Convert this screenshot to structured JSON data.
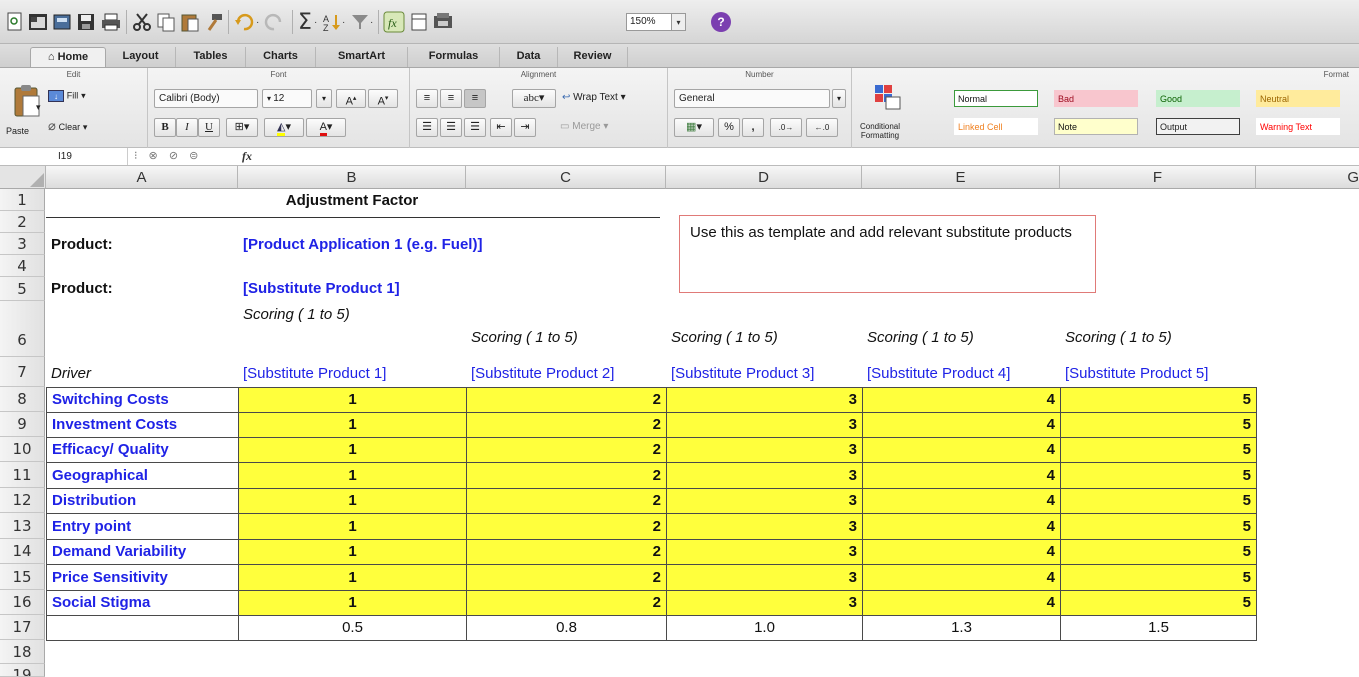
{
  "toolbar": {
    "zoom": "150%"
  },
  "tabs": [
    "Home",
    "Layout",
    "Tables",
    "Charts",
    "SmartArt",
    "Formulas",
    "Data",
    "Review"
  ],
  "ribbon": {
    "groups": {
      "edit": "Edit",
      "font": "Font",
      "alignment": "Alignment",
      "number": "Number",
      "format": "Format"
    },
    "paste": "Paste",
    "fill": "Fill",
    "clear": "Clear",
    "font_name": "Calibri (Body)",
    "font_size": "12",
    "wrap_text": "Wrap Text",
    "merge": "Merge",
    "abc": "abc",
    "number_format": "General",
    "percent": "%",
    "comma": ",",
    "conditional_formatting": [
      "Conditional",
      "Formatting"
    ],
    "styles": [
      {
        "label": "Normal",
        "bg": "#ffffff",
        "color": "#111111",
        "border": "#3b9a3b"
      },
      {
        "label": "Bad",
        "bg": "#f8c6ce",
        "color": "#9c0a1e",
        "border": "#f8c6ce"
      },
      {
        "label": "Good",
        "bg": "#c6efce",
        "color": "#0a6100",
        "border": "#c6efce"
      },
      {
        "label": "Neutral",
        "bg": "#ffeb9c",
        "color": "#9c6500",
        "border": "#ffeb9c"
      },
      {
        "label": "Linked Cell",
        "bg": "#ffffff",
        "color": "#f08020",
        "border": "#ffffff"
      },
      {
        "label": "Note",
        "bg": "#ffffcc",
        "color": "#111111",
        "border": "#b2b2b2"
      },
      {
        "label": "Output",
        "bg": "#f2f2f2",
        "color": "#222222",
        "border": "#3f3f3f"
      },
      {
        "label": "Warning Text",
        "bg": "#ffffff",
        "color": "#ff0000",
        "border": "#ffffff"
      }
    ]
  },
  "formula_bar": {
    "cell_ref": "I19",
    "fx": "fx"
  },
  "columns": [
    "A",
    "B",
    "C",
    "D",
    "E",
    "F",
    "G"
  ],
  "rows": [
    "1",
    "2",
    "3",
    "4",
    "5",
    "6",
    "7",
    "8",
    "9",
    "10",
    "11",
    "12",
    "13",
    "14",
    "15",
    "16",
    "17",
    "18",
    "19"
  ],
  "sheet": {
    "title": "Adjustment Factor",
    "product_label": "Product:",
    "product_value": "[Product Application 1 (e.g. Fuel)]",
    "substitute_label": "Product:",
    "substitute_value": "[Substitute Product 1]",
    "scoring": "Scoring ( 1 to 5)",
    "driver_header": "Driver",
    "substitutes": [
      "[Substitute Product 1]",
      "[Substitute Product 2]",
      "[Substitute Product 3]",
      "[Substitute Product 4]",
      "[Substitute Product 5]"
    ],
    "drivers": [
      "Switching Costs",
      "Investment Costs",
      "Efficacy/ Quality",
      "Geographical",
      "Distribution",
      "Entry point",
      "Demand Variability",
      "Price Sensitivity",
      "Social Stigma"
    ],
    "scores": [
      "1",
      "2",
      "3",
      "4",
      "5"
    ],
    "factors": [
      "0.5",
      "0.8",
      "1.0",
      "1.3",
      "1.5"
    ],
    "note": "Use this as template and add relevant substitute products"
  }
}
